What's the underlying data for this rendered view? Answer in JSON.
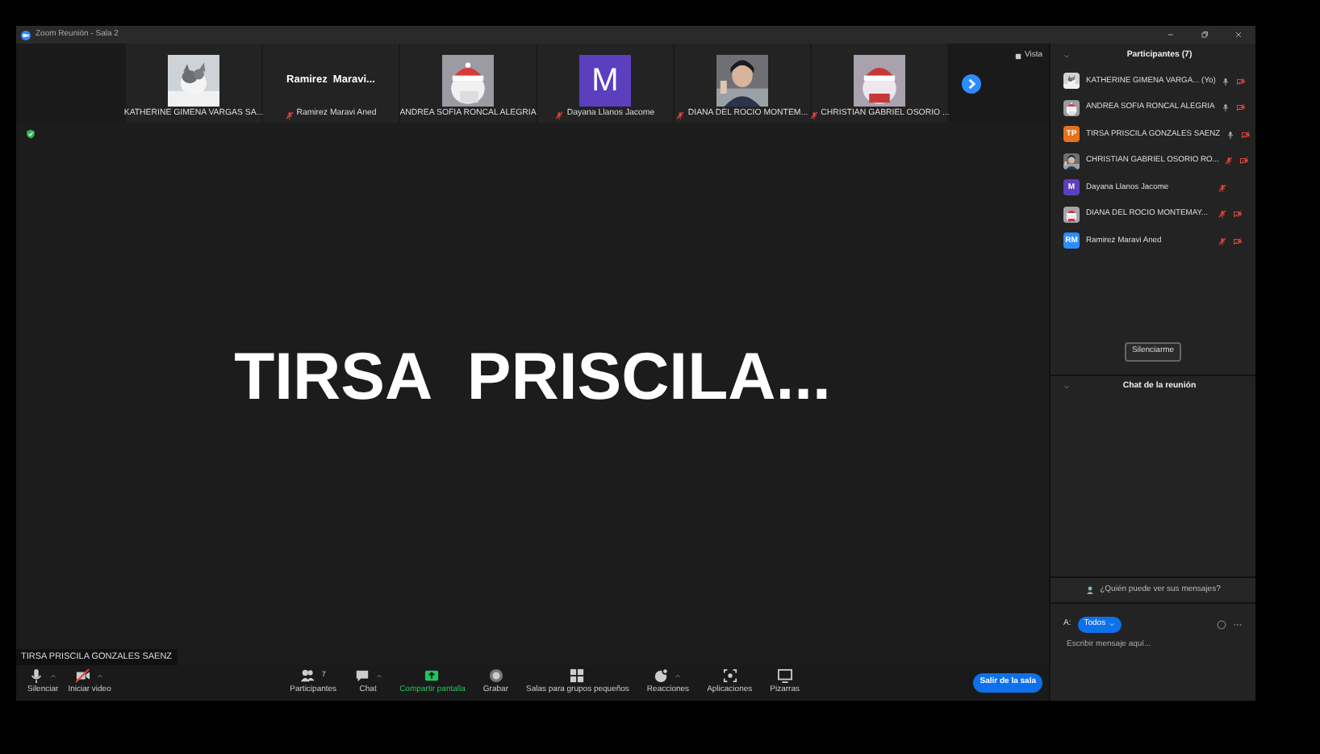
{
  "window": {
    "title": "Zoom Reunión - Sala 2"
  },
  "view_button": "Vista",
  "thumbnails": [
    {
      "kind": "picture",
      "name": "KATHERINE GIMENA VARGAS SA...",
      "muted": false
    },
    {
      "kind": "name",
      "display": "Ramirez  Maravi...",
      "name": "Ramirez Maravi Aned",
      "muted": true
    },
    {
      "kind": "picture",
      "name": "ANDREA SOFIA RONCAL ALEGRIA",
      "muted": false
    },
    {
      "kind": "letter",
      "display": "M",
      "color": "#5b3fbf",
      "name": "Dayana Llanos Jacome",
      "muted": true
    },
    {
      "kind": "picture",
      "name": "DIANA DEL ROCIO MONTEM...",
      "muted": true
    },
    {
      "kind": "picture",
      "name": "CHRISTIAN GABRIEL OSORIO ...",
      "muted": true
    }
  ],
  "speaker": {
    "display": "TIRSA  PRISCILA...",
    "name": "TIRSA PRISCILA GONZALES SAENZ"
  },
  "toolbar": [
    {
      "kind": "mic",
      "label": "Silenciar",
      "caret": true
    },
    {
      "kind": "video-off",
      "label": "Iniciar video",
      "caret": true
    },
    {
      "kind": "people",
      "label": "Participantes",
      "count": "7",
      "caret": false
    },
    {
      "kind": "chat",
      "label": "Chat",
      "caret": true
    },
    {
      "kind": "share",
      "label": "Compartir pantalla",
      "caret": false
    },
    {
      "kind": "record",
      "label": "Grabar",
      "caret": false
    },
    {
      "kind": "rooms",
      "label": "Salas para grupos pequeños",
      "caret": false
    },
    {
      "kind": "reactions",
      "label": "Reacciones",
      "caret": true
    },
    {
      "kind": "apps",
      "label": "Aplicaciones",
      "caret": false
    },
    {
      "kind": "whiteboard",
      "label": "Pizarras",
      "caret": false
    }
  ],
  "leave_button": "Salir de la sala",
  "participants": {
    "title": "Participantes (7)",
    "items": [
      {
        "kind": "picture",
        "name": "KATHERINE GIMENA VARGA... (Yo)",
        "muted": false,
        "video_off": true
      },
      {
        "kind": "picture",
        "name": "ANDREA SOFIA RONCAL ALEGRIA",
        "muted": false,
        "video_off": true
      },
      {
        "kind": "initials",
        "initials": "TP",
        "color": "#e8711c",
        "name": "TIRSA PRISCILA GONZALES SAENZ",
        "muted": false,
        "video_off": true
      },
      {
        "kind": "picture",
        "name": "CHRISTIAN GABRIEL OSORIO RO...",
        "muted": true,
        "video_off": true
      },
      {
        "kind": "initials",
        "initials": "M",
        "color": "#5b3fbf",
        "name": "Dayana Llanos Jacome",
        "muted": true,
        "video_off": false
      },
      {
        "kind": "picture",
        "name": "DIANA DEL ROCIO MONTEMAY...",
        "muted": true,
        "video_off": true
      },
      {
        "kind": "initials",
        "initials": "RM",
        "color": "#2d8cff",
        "name": "Ramirez Maravi Aned",
        "muted": true,
        "video_off": true
      }
    ],
    "mute_me": "Silenciarme"
  },
  "chat": {
    "title": "Chat de la reunión",
    "who_can_see": "¿Quién puede ver sus mensajes?",
    "to_label": "A:",
    "recipient": "Todos",
    "placeholder": "Escribir mensaje aquí..."
  }
}
